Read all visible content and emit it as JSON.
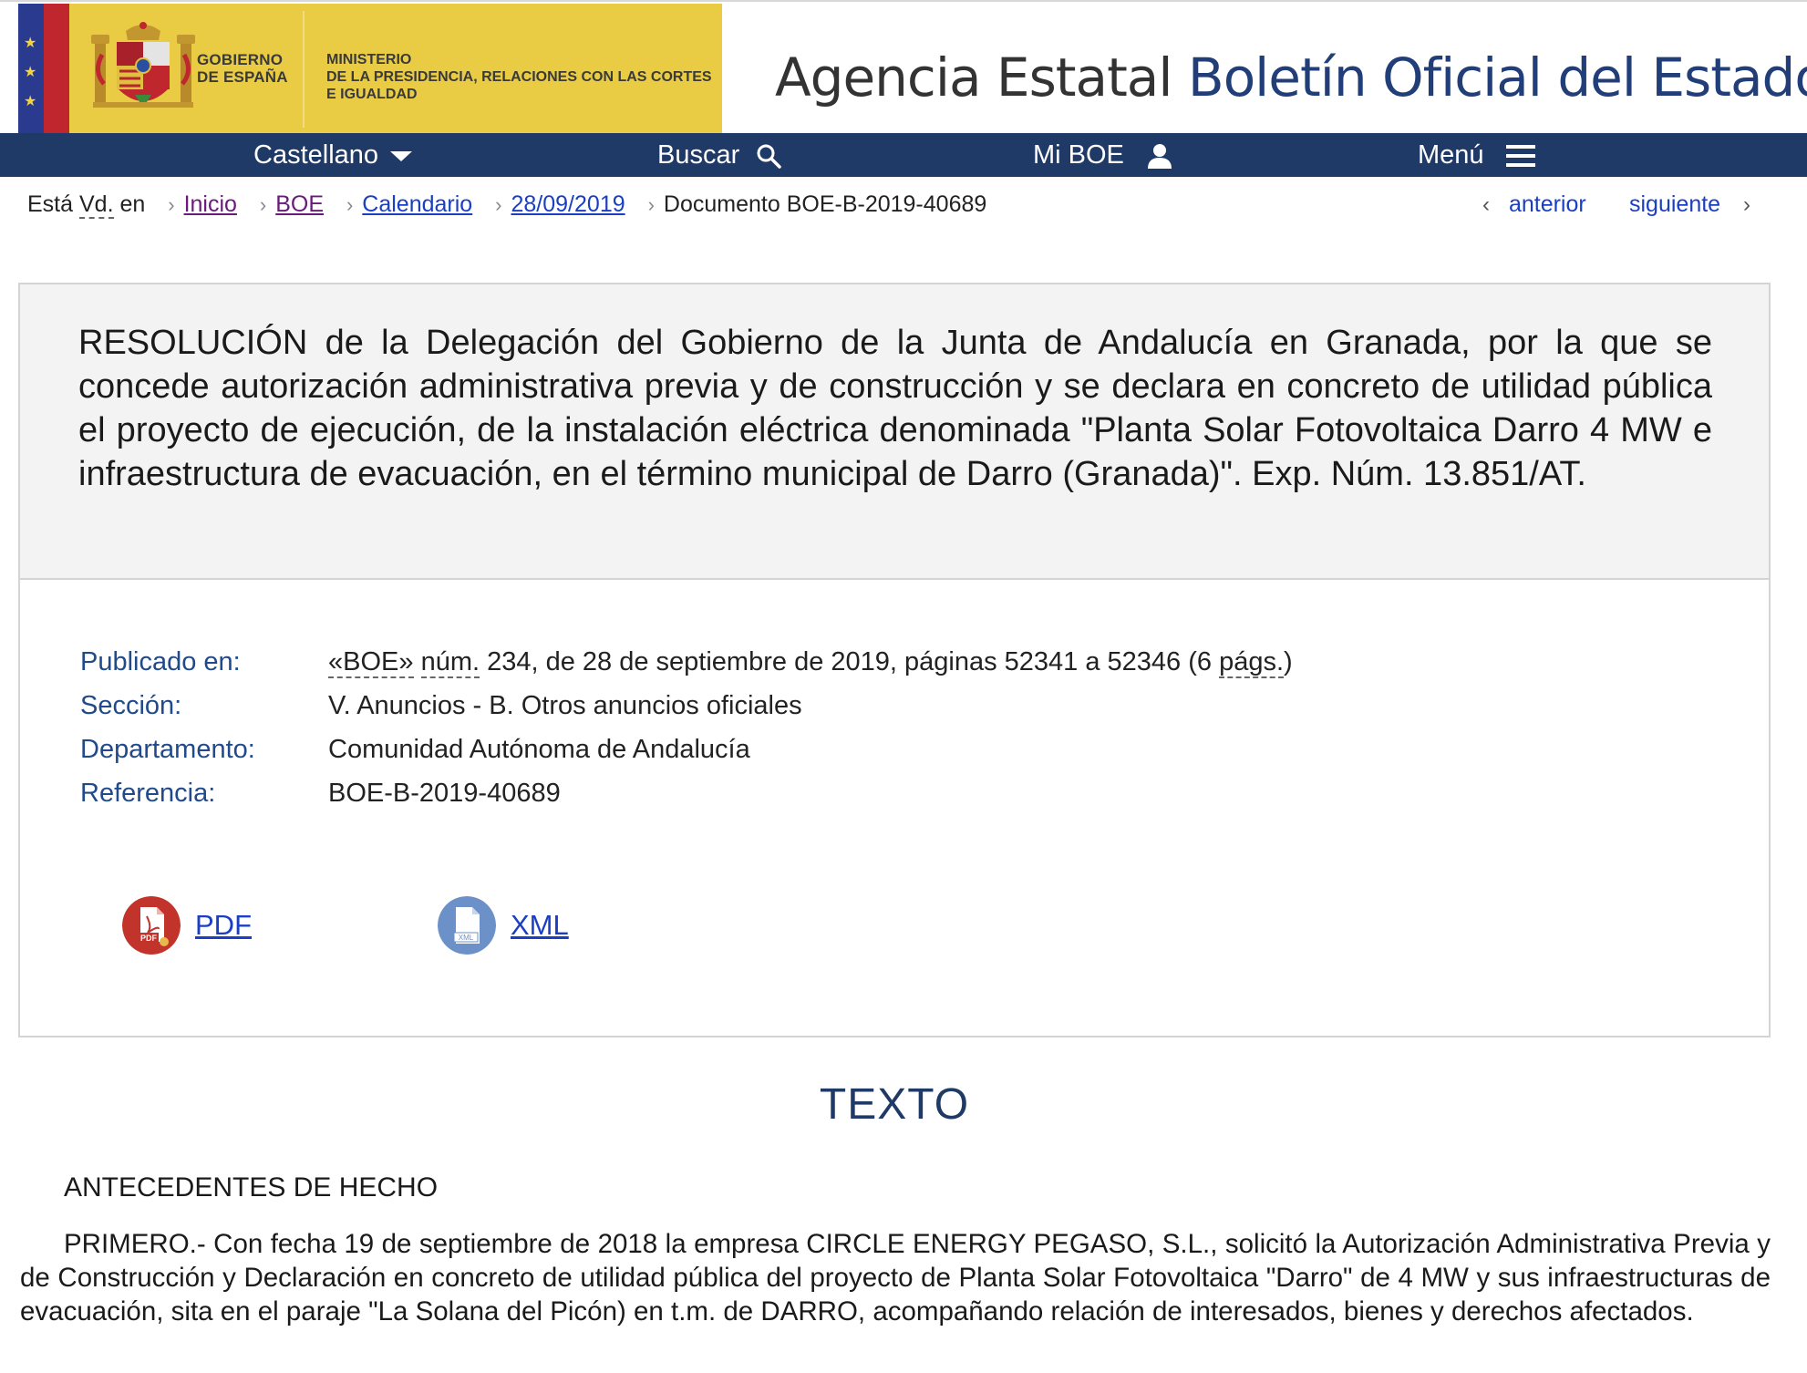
{
  "header": {
    "gov_line1": "GOBIERNO",
    "gov_line2": "DE ESPAÑA",
    "ministry_line1": "MINISTERIO",
    "ministry_line2": "DE LA PRESIDENCIA, RELACIONES CON LAS CORTES",
    "ministry_line3": "E IGUALDAD",
    "agency_prefix": "Agencia Estatal",
    "agency_name": "Boletín Oficial del Estado"
  },
  "nav": {
    "language": "Castellano",
    "search": "Buscar",
    "my_boe": "Mi BOE",
    "menu": "Menú"
  },
  "breadcrumb": {
    "intro_1": "Está",
    "intro_abbr": "Vd.",
    "intro_2": "en",
    "items": [
      "Inicio",
      "BOE",
      "Calendario",
      "28/09/2019"
    ],
    "current": "Documento BOE-B-2019-40689",
    "prev": "anterior",
    "next": "siguiente"
  },
  "document": {
    "title": "RESOLUCIÓN de la Delegación del Gobierno de la Junta de Andalucía en Granada, por la que se concede autorización administrativa previa y de construcción y se declara en concreto de utilidad pública el proyecto de ejecución, de la instalación eléctrica denominada \"Planta Solar Fotovoltaica Darro 4 MW e infraestructura de evacuación, en el término municipal de Darro (Granada)\". Exp. Núm. 13.851/AT.",
    "published_label": "Publicado en:",
    "published_boe": "«BOE»",
    "published_num_abbr": "núm.",
    "published_middle": "234, de 28 de septiembre de 2019, páginas 52341 a 52346 (6",
    "published_pags_abbr": "págs.",
    "published_end": ")",
    "section_label": "Sección:",
    "section_value": "V. Anuncios - B. Otros anuncios oficiales",
    "department_label": "Departamento:",
    "department_value": "Comunidad Autónoma de Andalucía",
    "reference_label": "Referencia:",
    "reference_value": "BOE-B-2019-40689",
    "pdf_label": "PDF",
    "xml_label": "XML"
  },
  "body": {
    "heading": "TEXTO",
    "subheading": "ANTECEDENTES DE HECHO",
    "paragraph": "PRIMERO.- Con fecha 19 de septiembre de 2018 la empresa CIRCLE ENERGY PEGASO, S.L., solicitó la Autorización Administrativa Previa y de Construcción y Declaración en concreto de utilidad pública del proyecto de Planta Solar Fotovoltaica \"Darro\" de 4 MW y sus infraestructuras de evacuación, sita en el paraje \"La Solana del Picón) en t.m. de DARRO, acompañando relación de interesados, bienes y derechos afectados."
  },
  "colors": {
    "nav_bg": "#1f3a66",
    "gov_yellow": "#e9cb44",
    "link_blue": "#1a3fc2",
    "label_blue": "#214a8a"
  },
  "icons": [
    "caret-down-icon",
    "magnifier-icon",
    "user-icon",
    "hamburger-icon",
    "chevron-left-icon",
    "chevron-right-icon",
    "pdf-icon",
    "xml-icon"
  ]
}
